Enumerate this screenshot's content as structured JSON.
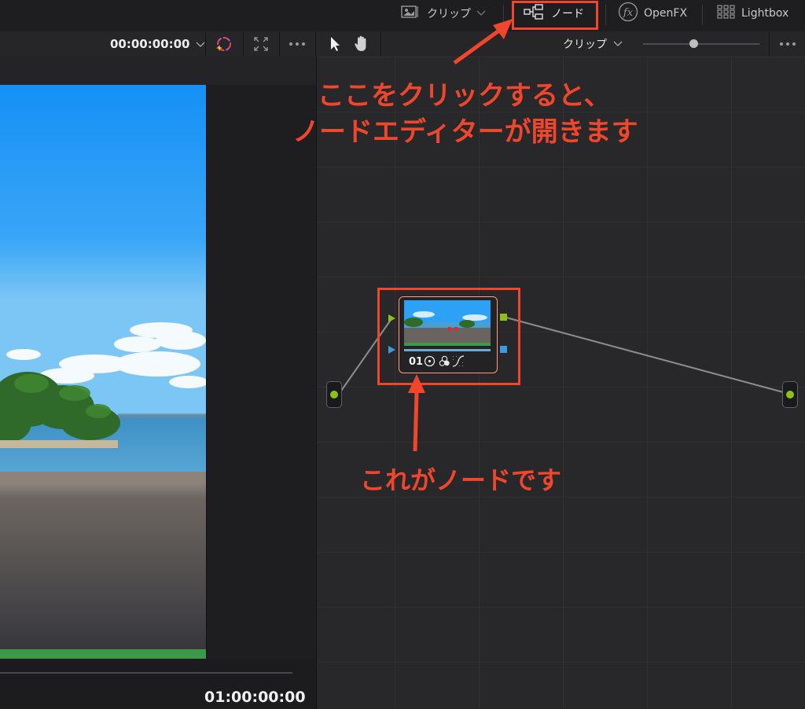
{
  "topbar": {
    "clip_label": "クリップ",
    "node_label": "ノード",
    "openfx_label": "OpenFX",
    "lightbox_label": "Lightbox"
  },
  "viewer": {
    "timecode_top": "00:00:00:00",
    "timecode_bottom": "01:00:00:00"
  },
  "node_editor": {
    "mode_label": "クリップ",
    "node_number": "01"
  },
  "annotations": {
    "callout_line1": "ここをクリックすると、",
    "callout_line2": "ノードエディターが開きます",
    "node_callout": "これがノードです"
  },
  "colors": {
    "annotation": "#f0462c",
    "rgb_port": "#8cc11c",
    "alpha_port": "#3a9be0"
  },
  "icons": [
    "clip-view-icon",
    "node-icon",
    "fx-icon",
    "lightbox-grid-icon",
    "color-wheel-icon",
    "expand-icon",
    "more-icon",
    "pointer-icon",
    "hand-icon",
    "chevron-down-icon"
  ]
}
